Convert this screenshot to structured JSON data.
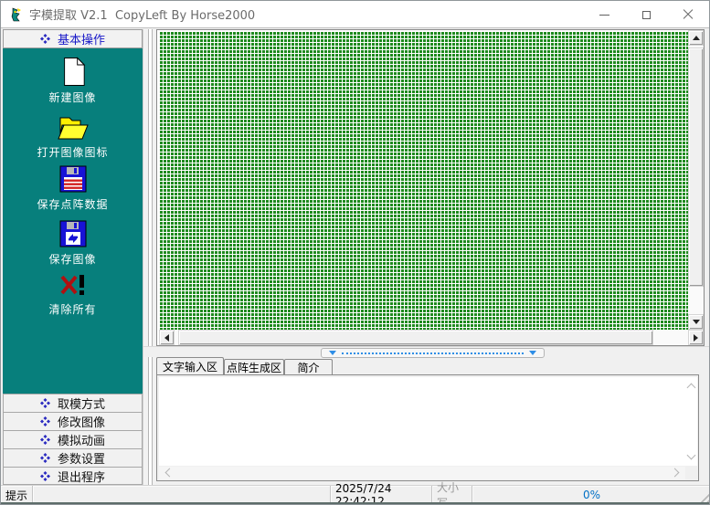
{
  "window": {
    "title": "字模提取 V2.1  CopyLeft By Horse2000"
  },
  "sidebar": {
    "header": {
      "label": "基本操作"
    },
    "tools": [
      {
        "label": "新建图像",
        "icon": "new-image-icon"
      },
      {
        "label": "打开图像图标",
        "icon": "open-image-icon"
      },
      {
        "label": "保存点阵数据",
        "icon": "save-dot-matrix-icon"
      },
      {
        "label": "保存图像",
        "icon": "save-image-icon"
      },
      {
        "label": "清除所有",
        "icon": "clear-all-icon"
      }
    ],
    "nav": [
      {
        "label": "取模方式"
      },
      {
        "label": "修改图像"
      },
      {
        "label": "模拟动画"
      },
      {
        "label": "参数设置"
      },
      {
        "label": "退出程序"
      }
    ]
  },
  "tabs": [
    {
      "label": "文字输入区",
      "active": true
    },
    {
      "label": "点阵生成区",
      "active": false
    },
    {
      "label": "简介",
      "active": false
    }
  ],
  "editor": {
    "value": ""
  },
  "statusbar": {
    "hint": "提示",
    "message": "",
    "timestamp": "2025/7/24 22:42:12",
    "case_indicator": "大小写",
    "progress": "0%"
  },
  "colors": {
    "sidebar_teal": "#077f7c",
    "canvas_green": "#1e8a1e",
    "accent_blue": "#1818c8",
    "progress_blue": "#0070c5"
  }
}
